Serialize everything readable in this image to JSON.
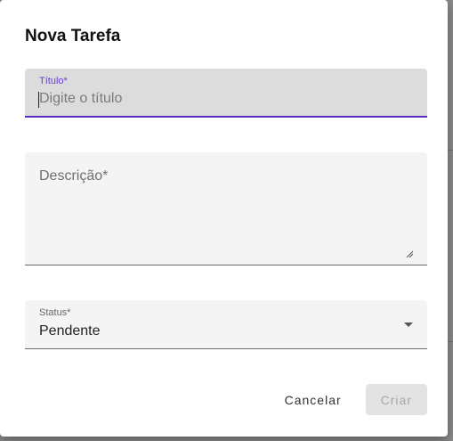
{
  "dialog": {
    "title": "Nova Tarefa"
  },
  "fields": {
    "title": {
      "label": "Título*",
      "placeholder": "Digite o título",
      "value": ""
    },
    "description": {
      "label": "Descrição*",
      "value": ""
    },
    "status": {
      "label": "Status*",
      "selected": "Pendente"
    }
  },
  "actions": {
    "cancel_label": "Cancelar",
    "create_label": "Criar"
  },
  "colors": {
    "focus_accent": "#5b2fc0",
    "focus_label": "#6a3fd0"
  },
  "icons": {
    "dropdown": "chevron-down-icon",
    "resize": "resize-handle-icon"
  }
}
